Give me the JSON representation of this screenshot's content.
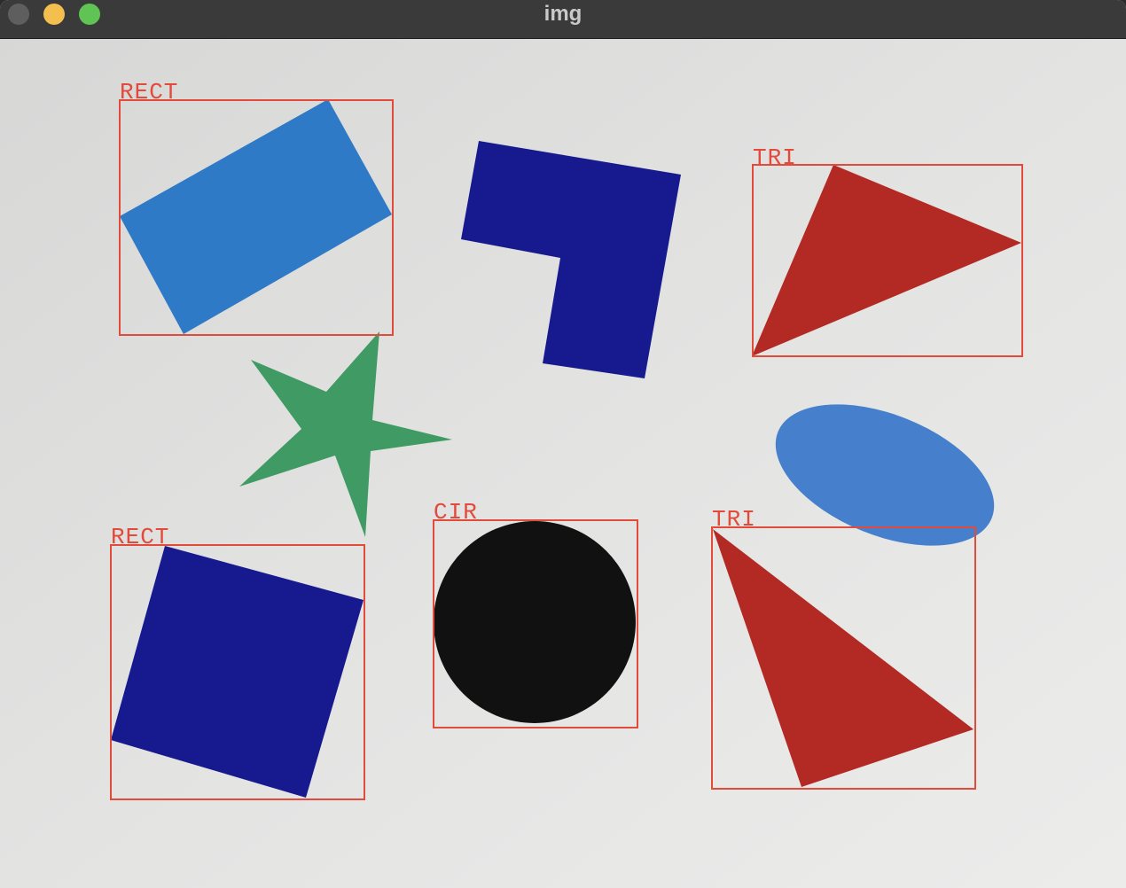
{
  "window": {
    "title": "img",
    "buttons": [
      "close",
      "minimize",
      "maximize"
    ]
  },
  "colors": {
    "titlebar": "#3a3a3a",
    "paper": "#dcdcdb",
    "annotation": "#e24a3c",
    "light_blue": "#2f7ac6",
    "dark_blue": "#17198e",
    "red": "#b32923",
    "green": "#3f9a63",
    "black": "#111111",
    "ellipse_blue": "#4680cc"
  },
  "detections": [
    {
      "label": "RECT",
      "shape": "rectangle"
    },
    {
      "label": "TRI",
      "shape": "triangle"
    },
    {
      "label": "RECT",
      "shape": "square"
    },
    {
      "label": "CIR",
      "shape": "circle"
    },
    {
      "label": "TRI",
      "shape": "triangle"
    }
  ]
}
